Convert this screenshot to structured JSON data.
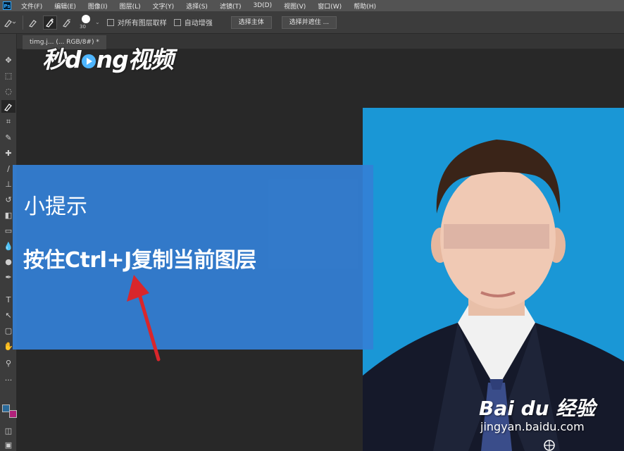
{
  "app": {
    "logo_text": "Ps"
  },
  "menu": [
    "文件(F)",
    "编辑(E)",
    "图像(I)",
    "图层(L)",
    "文字(Y)",
    "选择(S)",
    "滤镜(T)",
    "3D(D)",
    "视图(V)",
    "窗口(W)",
    "帮助(H)"
  ],
  "options": {
    "brush_size": "30",
    "sample_all_layers_label": "对所有图层取样",
    "auto_enhance_label": "自动增强",
    "select_subject_label": "选择主体",
    "select_mask_label": "选择并遮住 ..."
  },
  "document_tab": {
    "label": "timg.j...  (... RGB/8#) *"
  },
  "watermark": {
    "prefix": "秒d",
    "suffix": "ng视频"
  },
  "tip": {
    "title": "小提示",
    "text": "按住Ctrl+J复制当前图层"
  },
  "baidu": {
    "brand": "Bai du 经验",
    "url": "jingyan.baidu.com"
  },
  "colors": {
    "photo_background": "#1a97d6",
    "tip_panel": "#3480d6",
    "arrow": "#d9262b",
    "foreground_swatch": "#2a6a9a",
    "background_swatch": "#b0217a"
  },
  "icons": {
    "toolbar": [
      "move-icon",
      "marquee-icon",
      "lasso-icon",
      "quick-select-icon",
      "crop-icon",
      "eyedropper-icon",
      "healing-brush-icon",
      "brush-icon",
      "stamp-icon",
      "history-brush-icon",
      "eraser-icon",
      "gradient-icon",
      "blur-icon",
      "dodge-icon",
      "pen-icon",
      "type-icon",
      "path-select-icon",
      "shape-icon",
      "hand-icon",
      "zoom-icon",
      "more-tools-icon"
    ]
  }
}
